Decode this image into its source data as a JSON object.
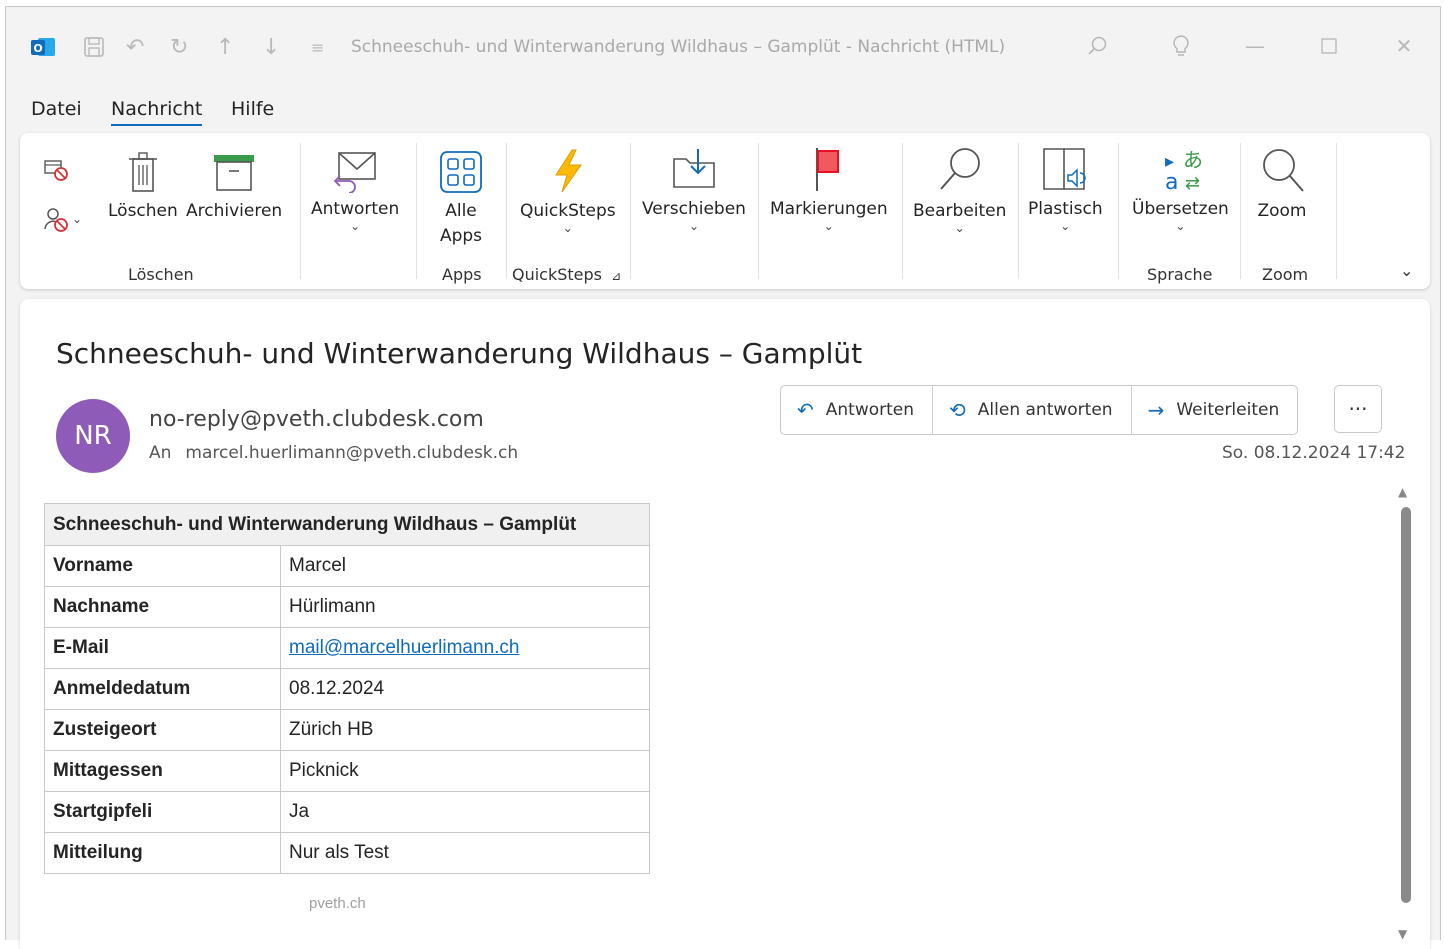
{
  "titlebar": {
    "app_icon": "outlook-icon",
    "title": "Schneeschuh- und Winterwanderung Wildhaus – Gamplüt  -  Nachricht (HTML)",
    "quick_access": [
      "save-icon",
      "undo-icon",
      "redo-icon",
      "up-arrow-icon",
      "down-arrow-icon",
      "customize-icon"
    ],
    "right_icons": [
      "search-icon",
      "lightbulb-icon",
      "minimize-icon",
      "maximize-icon",
      "close-icon"
    ]
  },
  "menu": {
    "items": [
      "Datei",
      "Nachricht",
      "Hilfe"
    ],
    "active": "Nachricht"
  },
  "ribbon": {
    "buttons": {
      "ignore": "ignore-icon",
      "block": "block-sender-icon",
      "loeschen": "Löschen",
      "archivieren": "Archivieren",
      "antworten": "Antworten",
      "alle_apps_1": "Alle",
      "alle_apps_2": "Apps",
      "quicksteps": "QuickSteps",
      "verschieben": "Verschieben",
      "markierungen": "Markierungen",
      "bearbeiten": "Bearbeiten",
      "plastisch": "Plastisch",
      "uebersetzen": "Übersetzen",
      "zoom": "Zoom"
    },
    "groups": {
      "loeschen": "Löschen",
      "apps": "Apps",
      "quicksteps": "QuickSteps",
      "sprache": "Sprache",
      "zoom": "Zoom"
    },
    "accent_color": "#0f6cbd"
  },
  "message": {
    "subject": "Schneeschuh- und Winterwanderung Wildhaus – Gamplüt",
    "avatar_initials": "NR",
    "avatar_color": "#8e5cb8",
    "sender": "no-reply@pveth.clubdesk.com",
    "to_label": "An",
    "to": "marcel.huerlimann@pveth.clubdesk.ch",
    "date": "So. 08.12.2024 17:42",
    "actions": {
      "reply": "Antworten",
      "reply_all": "Allen antworten",
      "forward": "Weiterleiten",
      "more": "···"
    }
  },
  "form_table": {
    "header": "Schneeschuh- und Winterwanderung Wildhaus – Gamplüt",
    "rows": [
      {
        "key": "Vorname",
        "value": "Marcel"
      },
      {
        "key": "Nachname",
        "value": "Hürlimann"
      },
      {
        "key": "E-Mail",
        "value": "mail@marcelhuerlimann.ch"
      },
      {
        "key": "Anmeldedatum",
        "value": "08.12.2024"
      },
      {
        "key": "Zusteigeort",
        "value": "Zürich HB"
      },
      {
        "key": "Mittagessen",
        "value": "Picknick"
      },
      {
        "key": "Startgipfeli",
        "value": "Ja"
      },
      {
        "key": "Mitteilung",
        "value": "Nur als Test"
      }
    ],
    "footer": "pveth.ch"
  }
}
